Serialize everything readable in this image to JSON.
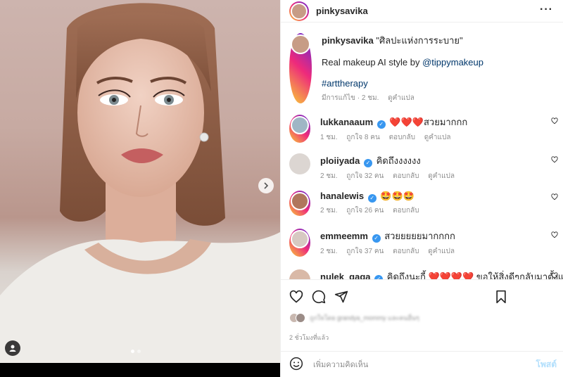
{
  "post": {
    "username": "pinkysavika",
    "more_icon": "more-horizontal-icon"
  },
  "caption": {
    "username": "pinkysavika",
    "title": "\"ศิลปะแห่งการระบาย\"",
    "line1_prefix": "Real makeup AI style by ",
    "line1_mention": "@tippymakeup",
    "hashtag": "#arttherapy",
    "edited": "มีการแก้ไข · 2 ชม.",
    "see_translation": "ดูคำแปล"
  },
  "comments": [
    {
      "username": "lukkanaaum",
      "verified": true,
      "text": "❤️❤️❤️สวยมากกก",
      "time": "1 ชม.",
      "likes": "ถูกใจ 8 คน",
      "reply": "ตอบกลับ",
      "translate": "ดูคำแปล"
    },
    {
      "username": "ploiiyada",
      "verified": true,
      "text": "คิดถึงงงงงง",
      "time": "2 ชม.",
      "likes": "ถูกใจ 32 คน",
      "reply": "ตอบกลับ",
      "translate": "ดูคำแปล"
    },
    {
      "username": "hanalewis",
      "verified": true,
      "text": "🤩🤩🤩",
      "time": "2 ชม.",
      "likes": "ถูกใจ 26 คน",
      "reply": "ตอบกลับ",
      "translate": ""
    },
    {
      "username": "emmeemm",
      "verified": true,
      "text": "สวยยยยยมากกกก",
      "time": "2 ชม.",
      "likes": "ถูกใจ 37 คน",
      "reply": "ตอบกลับ",
      "translate": "ดูคำแปล"
    },
    {
      "username": "nulek_gaga",
      "verified": true,
      "text": "คิดถึงนะกี้ ❤️❤️❤️❤️ ขอให้สิ่งดีๆกลับมาตั้งแต่",
      "time": "",
      "likes": "",
      "reply": "",
      "translate": ""
    }
  ],
  "actions": {
    "likes_text": "ถูกใจโดย grandya_mommy และคนอื่นๆ",
    "time": "2 ชั่วโมงที่แล้ว"
  },
  "add_comment": {
    "placeholder": "เพิ่มความคิดเห็น",
    "post_label": "โพสต์"
  },
  "colors": {
    "link": "#00376b",
    "verified": "#3897f0",
    "muted": "#8e8e8e",
    "post_button_disabled": "#b2dffc"
  }
}
